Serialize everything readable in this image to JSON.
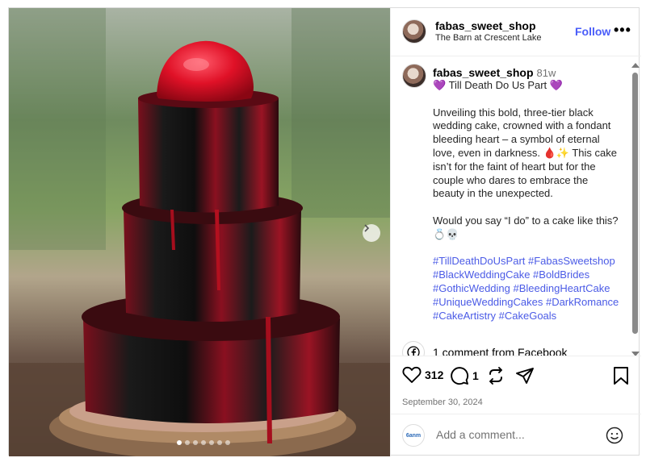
{
  "post": {
    "username": "fabas_sweet_shop",
    "location": "The Barn at Crescent Lake",
    "follow_label": "Follow",
    "more_label": "•••",
    "age": "81w",
    "caption_title": "💜 Till Death Do Us Part 💜",
    "caption_body": "Unveiling this bold, three-tier black wedding cake, crowned with a fondant bleeding heart – a symbol of eternal love, even in darkness. 🩸✨ This cake isn’t for the faint of heart but for the couple who dares to embrace the beauty in the unexpected.",
    "caption_question": "Would you say “I do” to a cake like this? 💍💀",
    "hashtags": "#TillDeathDoUsPart #FabasSweetshop #BlackWeddingCake #BoldBrides #GothicWedding #BleedingHeartCake #UniqueWeddingCakes #DarkRomance #CakeArtistry #CakeGoals",
    "comments_link": "1 comment from Facebook",
    "likes": "312",
    "comments_count": "1",
    "date": "September 30, 2024"
  },
  "carousel": {
    "total_slides": 7,
    "active_index": 0
  },
  "comment_box": {
    "placeholder": "Add a comment...",
    "avatar_text": "6anm"
  },
  "icons": [
    "next-arrow-icon",
    "facebook-icon",
    "heart-icon",
    "comment-icon",
    "share-icon",
    "send-icon",
    "bookmark-icon",
    "emoji-icon"
  ],
  "colors": {
    "accent": "#4a5df9",
    "hashtag": "#4b5be6",
    "muted": "#737373",
    "cake_red": "#c0102a",
    "cake_black": "#151515"
  }
}
